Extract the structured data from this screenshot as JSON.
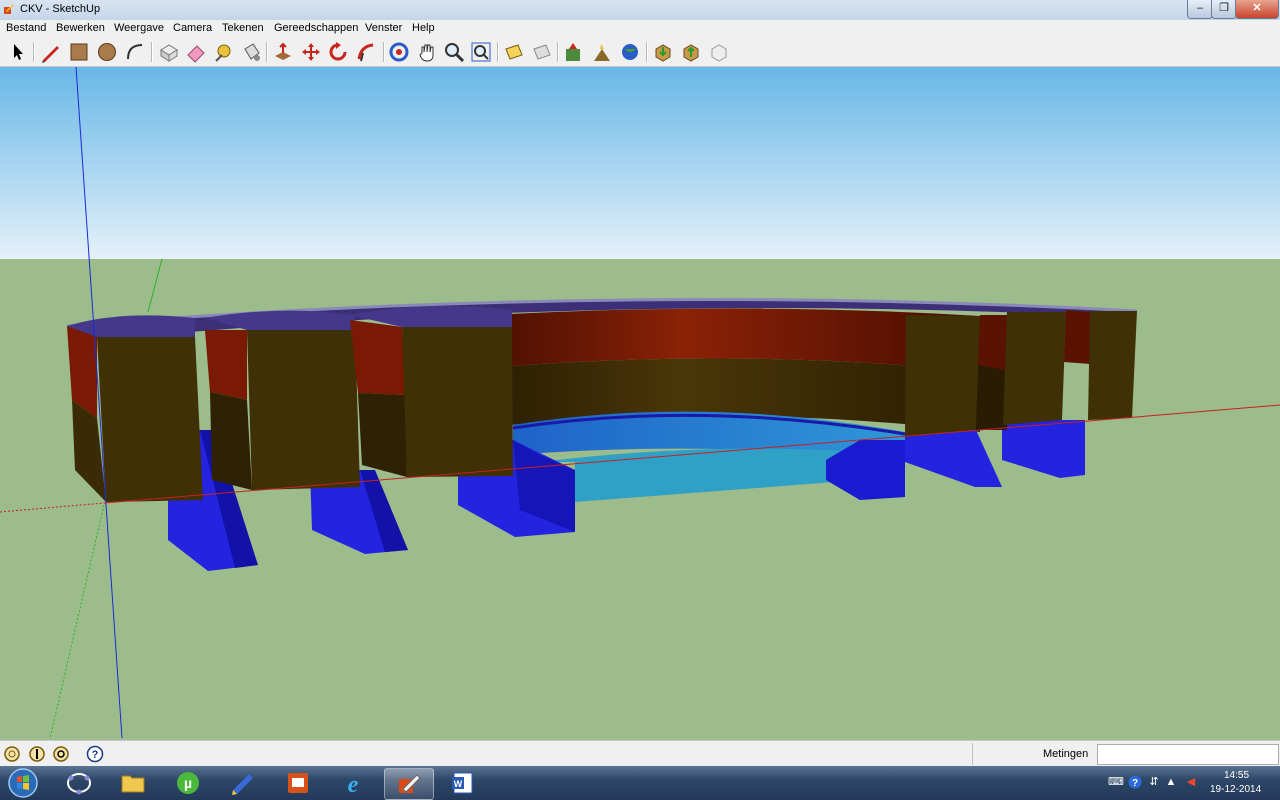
{
  "window": {
    "title": "CKV - SketchUp",
    "min": "–",
    "max": "❐",
    "close": "✕"
  },
  "menu": [
    "Bestand",
    "Bewerken",
    "Weergave",
    "Camera",
    "Tekenen",
    "Gereedschappen",
    "Venster",
    "Help"
  ],
  "toolbar": [
    "select-tool",
    "pencil-tool",
    "rectangle-tool",
    "circle-tool",
    "arc-tool",
    "make-component-tool",
    "eraser-tool",
    "tape-measure-tool",
    "paint-bucket-tool",
    "push-pull-tool",
    "move-tool",
    "rotate-tool",
    "follow-me-tool",
    "orbit-tool",
    "pan-tool",
    "zoom-tool",
    "zoom-extents-tool",
    "previous-view-tool",
    "next-view-tool",
    "add-location-tool",
    "toggle-terrain-tool",
    "preview-google-earth-tool",
    "get-models-tool",
    "share-model-tool",
    "share-component-tool"
  ],
  "status": {
    "measurements_label": "Metingen",
    "measurements_value": ""
  },
  "taskbar": {
    "apps": [
      "geogebra-icon",
      "file-explorer-icon",
      "utorrent-icon",
      "sketchup-layout-icon",
      "powerpoint-icon",
      "internet-explorer-icon",
      "sketchup-icon",
      "word-icon"
    ],
    "time": "14:55",
    "date": "19-12-2014"
  },
  "colors": {
    "sky": "#7fc3ea",
    "ground": "#9cbc8c",
    "wall_red": "#7b1a05",
    "wall_brown": "#3a2a05",
    "wall_blue": "#2222d8"
  }
}
